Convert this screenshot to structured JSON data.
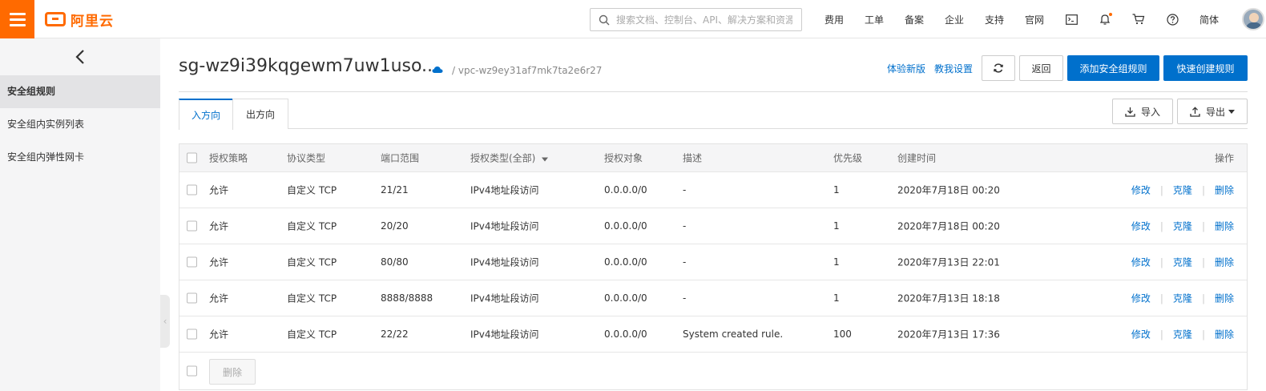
{
  "topbar": {
    "logo_text": "阿里云",
    "search_placeholder": "搜索文档、控制台、API、解决方案和资源",
    "nav": [
      "费用",
      "工单",
      "备案",
      "企业",
      "支持",
      "官网"
    ],
    "lang": "简体",
    "accent": "#ff6a00"
  },
  "sidebar": {
    "items": [
      {
        "label": "安全组规则",
        "active": true
      },
      {
        "label": "安全组内实例列表",
        "active": false
      },
      {
        "label": "安全组内弹性网卡",
        "active": false
      }
    ]
  },
  "header": {
    "title": "sg-wz9i39kqgewm7uw1uso...",
    "vpc": "/ vpc-wz9ey31af7mk7ta2e6r27",
    "link_new": "体验新版",
    "link_guide": "教我设置",
    "back": "返回",
    "add_rule": "添加安全组规则",
    "quick_create": "快速创建规则"
  },
  "tabs": [
    {
      "label": "入方向",
      "active": true
    },
    {
      "label": "出方向",
      "active": false
    }
  ],
  "toolbar": {
    "import": "导入",
    "export": "导出"
  },
  "table": {
    "columns": [
      "授权策略",
      "协议类型",
      "端口范围",
      "授权类型(全部)",
      "授权对象",
      "描述",
      "优先级",
      "创建时间",
      "操作"
    ],
    "rows": [
      {
        "policy": "允许",
        "protocol": "自定义 TCP",
        "port": "21/21",
        "auth_type": "IPv4地址段访问",
        "object": "0.0.0.0/0",
        "desc": "-",
        "priority": "1",
        "created": "2020年7月18日 00:20"
      },
      {
        "policy": "允许",
        "protocol": "自定义 TCP",
        "port": "20/20",
        "auth_type": "IPv4地址段访问",
        "object": "0.0.0.0/0",
        "desc": "-",
        "priority": "1",
        "created": "2020年7月18日 00:20"
      },
      {
        "policy": "允许",
        "protocol": "自定义 TCP",
        "port": "80/80",
        "auth_type": "IPv4地址段访问",
        "object": "0.0.0.0/0",
        "desc": "-",
        "priority": "1",
        "created": "2020年7月13日 22:01"
      },
      {
        "policy": "允许",
        "protocol": "自定义 TCP",
        "port": "8888/8888",
        "auth_type": "IPv4地址段访问",
        "object": "0.0.0.0/0",
        "desc": "-",
        "priority": "1",
        "created": "2020年7月13日 18:18"
      },
      {
        "policy": "允许",
        "protocol": "自定义 TCP",
        "port": "22/22",
        "auth_type": "IPv4地址段访问",
        "object": "0.0.0.0/0",
        "desc": "System created rule.",
        "priority": "100",
        "created": "2020年7月13日 17:36"
      }
    ],
    "ops": {
      "edit": "修改",
      "clone": "克隆",
      "delete": "删除"
    },
    "bulk_delete": "删除"
  },
  "colors": {
    "primary": "#0070cc",
    "brand": "#ff6a00"
  }
}
